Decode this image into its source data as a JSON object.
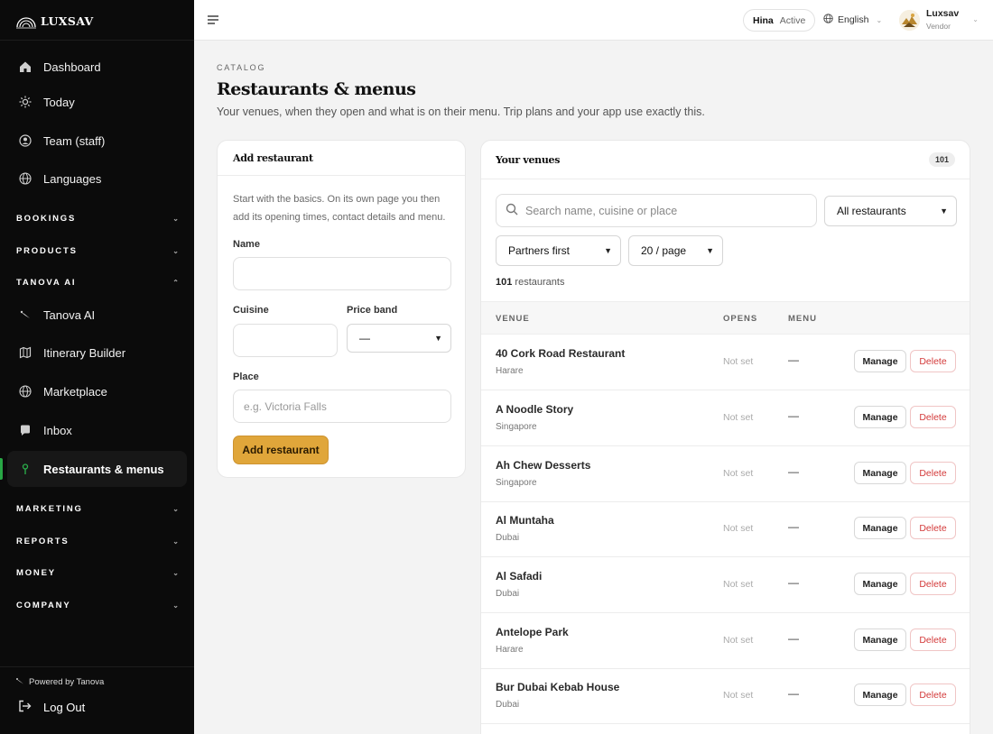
{
  "brand": {
    "name": "LUXSAV"
  },
  "sidebar": {
    "top_items": [
      {
        "label": "Dashboard",
        "icon": "home-icon"
      },
      {
        "label": "Today",
        "icon": "sun-icon"
      },
      {
        "label": "Team (staff)",
        "icon": "team-icon"
      },
      {
        "label": "Languages",
        "icon": "globe-icon"
      }
    ],
    "sections": {
      "bookings": "BOOKINGS",
      "products": "PRODUCTS",
      "tanova_ai": "TANOVA AI",
      "marketing": "MARKETING",
      "reports": "REPORTS",
      "money": "MONEY",
      "company": "COMPANY"
    },
    "ai_items": [
      {
        "label": "Tanova AI",
        "icon": "sparkle-icon"
      },
      {
        "label": "Itinerary Builder",
        "icon": "map-icon"
      },
      {
        "label": "Marketplace",
        "icon": "globe-icon"
      },
      {
        "label": "Inbox",
        "icon": "chat-icon"
      },
      {
        "label": "Restaurants & menus",
        "icon": "pin-icon",
        "active": true
      }
    ],
    "powered_by": "Powered by Tanova",
    "logout": "Log Out",
    "active_color": "#28a745"
  },
  "topbar": {
    "user_name": "Hina",
    "user_status": "Active",
    "language": "English",
    "account_name": "Luxsav",
    "account_role": "Vendor"
  },
  "page": {
    "eyebrow": "CATALOG",
    "title": "Restaurants & menus",
    "subtitle": "Your venues, when they open and what is on their menu. Trip plans and your app use exactly this."
  },
  "add_form": {
    "title": "Add restaurant",
    "help": "Start with the basics. On its own page you then add its opening times, contact details and menu.",
    "name_label": "Name",
    "name_value": "",
    "cuisine_label": "Cuisine",
    "cuisine_value": "",
    "price_label": "Price band",
    "price_value": "—",
    "place_label": "Place",
    "place_placeholder": "e.g. Victoria Falls",
    "submit": "Add restaurant",
    "accent": "#e0a63a"
  },
  "venues": {
    "title": "Your venues",
    "count": "101",
    "search_placeholder": "Search name, cuisine or place",
    "filter": "All restaurants",
    "sort": "Partners first",
    "per_page": "20 / page",
    "results_count": "101",
    "results_suffix": "restaurants",
    "columns": {
      "venue": "VENUE",
      "opens": "OPENS",
      "menu": "MENU"
    },
    "manage_label": "Manage",
    "delete_label": "Delete",
    "rows": [
      {
        "name": "40 Cork Road Restaurant",
        "place": "Harare",
        "opens": "Not set",
        "menu": "—"
      },
      {
        "name": "A Noodle Story",
        "place": "Singapore",
        "opens": "Not set",
        "menu": "—"
      },
      {
        "name": "Ah Chew Desserts",
        "place": "Singapore",
        "opens": "Not set",
        "menu": "—"
      },
      {
        "name": "Al Muntaha",
        "place": "Dubai",
        "opens": "Not set",
        "menu": "—"
      },
      {
        "name": "Al Safadi",
        "place": "Dubai",
        "opens": "Not set",
        "menu": "—"
      },
      {
        "name": "Antelope Park",
        "place": "Harare",
        "opens": "Not set",
        "menu": "—"
      },
      {
        "name": "Bur Dubai Kebab House",
        "place": "Dubai",
        "opens": "Not set",
        "menu": "—"
      }
    ]
  }
}
